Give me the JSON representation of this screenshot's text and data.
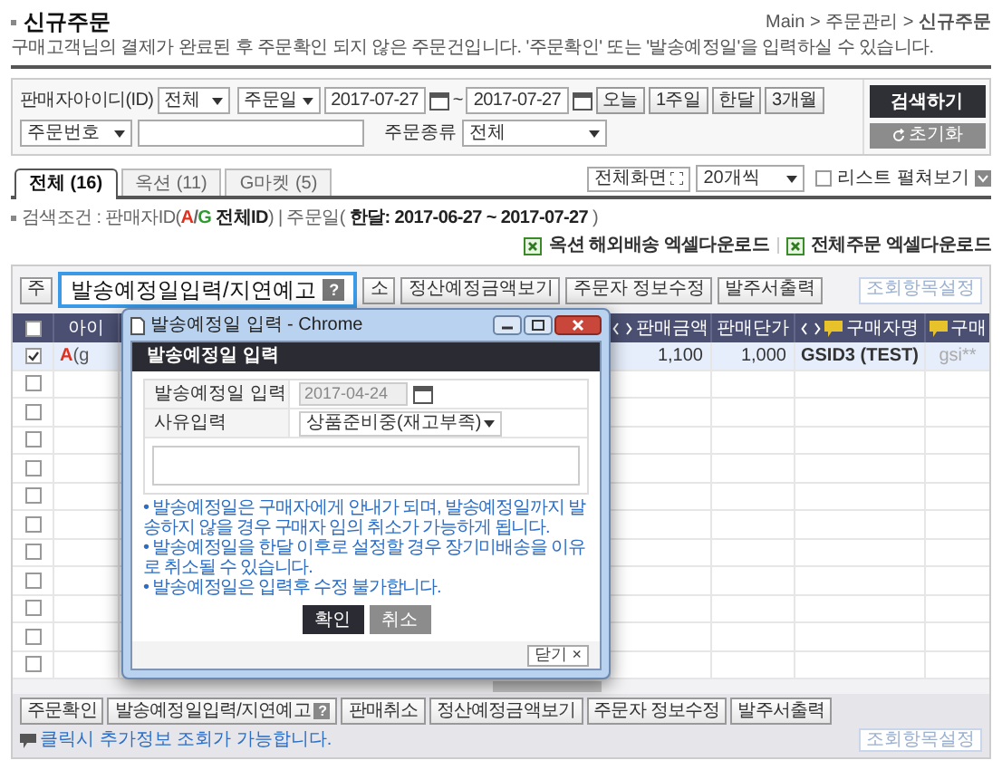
{
  "header": {
    "title": "신규주문",
    "description": "구매고객님의 결제가 완료된 후 주문확인 되지 않은 주문건입니다. '주문확인' 또는 '발송예정일'을 입력하실 수 있습니다.",
    "breadcrumb": "Main > 주문관리 > **신규주문**"
  },
  "search": {
    "seller_label": "판매자아이디(ID)",
    "seller_select": "전체",
    "date_type_select": "주문일",
    "date_from": "2017-07-27",
    "date_separator": "~",
    "date_to": "2017-07-27",
    "period_buttons": [
      "오늘",
      "1주일",
      "한달",
      "3개월"
    ],
    "order_field_select": "주문번호",
    "order_type_label": "주문종류",
    "order_type_select": "전체",
    "search_button": "검색하기",
    "reset_button": "초기화"
  },
  "tabs": [
    {
      "label": "전체 (16)",
      "selected": true
    },
    {
      "label": "옥션 (11)",
      "selected": false
    },
    {
      "label": "G마켓 (5)",
      "selected": false
    }
  ],
  "list_options": {
    "fullscreen_button": "전체화면",
    "page_size_select": "20개씩",
    "expand_list": {
      "label": "리스트 펼쳐보기",
      "checked": false
    }
  },
  "conditions": [
    {
      "text": "검색조건 : 판매자ID(",
      "color": "#666666",
      "bold": false
    },
    {
      "text": "A",
      "color": "#e0301e",
      "bold": true
    },
    {
      "text": "/",
      "color": "#666666",
      "bold": true
    },
    {
      "text": "G",
      "color": "#2f9a30",
      "bold": true
    },
    {
      "text": " 전체ID",
      "color": "#222222",
      "bold": true
    },
    {
      "text": ") | 주문일( ",
      "color": "#666666",
      "bold": false
    },
    {
      "text": "한달: 2017-06-27 ~ 2017-07-27",
      "color": "#222222",
      "bold": true
    },
    {
      "text": " )",
      "color": "#666666",
      "bold": false
    }
  ],
  "downloads": [
    "옥션 해외배송 엑셀다운로드",
    "전체주문 엑셀다운로드"
  ],
  "toolbar": {
    "buttons": [
      {
        "label": "주",
        "kind": "plain"
      },
      {
        "label": "발송예정일입력/지연예고",
        "kind": "highlighted",
        "help_icon": "?"
      },
      {
        "label": "소",
        "kind": "plain"
      },
      {
        "label": "정산예정금액보기",
        "kind": "plain"
      },
      {
        "label": "주문자 정보수정",
        "kind": "plain"
      },
      {
        "label": "발주서출력",
        "kind": "plain"
      }
    ],
    "settings_button": "조회항목설정"
  },
  "table": {
    "select_all_checked": false,
    "columns": [
      {
        "label": "아이",
        "sortable": false,
        "comment_icon": false
      },
      {
        "label": "판매금액",
        "sortable": true,
        "comment_icon": false
      },
      {
        "label": "판매단가",
        "sortable": false,
        "comment_icon": false
      },
      {
        "label": "구매자명",
        "sortable": true,
        "comment_icon": true
      },
      {
        "label": "구매",
        "sortable": false,
        "comment_icon": true
      }
    ],
    "rows": [
      {
        "checked": true,
        "selected": true,
        "market": {
          "label": "A",
          "color": "#e0301e"
        },
        "cells": [
          "(g",
          "1,100",
          "1,000",
          "GSID3 (TEST)",
          "gsi**"
        ]
      },
      {
        "checked": false,
        "selected": false
      },
      {
        "checked": false,
        "selected": false
      },
      {
        "checked": false,
        "selected": false
      },
      {
        "checked": false,
        "selected": false
      },
      {
        "checked": false,
        "selected": false
      },
      {
        "checked": false,
        "selected": false
      },
      {
        "checked": false,
        "selected": false
      },
      {
        "checked": false,
        "selected": false
      },
      {
        "checked": false,
        "selected": false
      },
      {
        "checked": false,
        "selected": false
      },
      {
        "checked": false,
        "selected": false
      }
    ]
  },
  "popup": {
    "window_title": "발송예정일 입력 - Chrome",
    "heading": "발송예정일 입력",
    "fields": [
      {
        "label": "발송예정일 입력",
        "kind": "date",
        "value": "2017-04-24"
      },
      {
        "label": "사유입력",
        "kind": "select",
        "value": "상품준비중(재고부족)"
      }
    ],
    "notes": [
      "• 발송예정일은 구매자에게 안내가 되며, 발송예정일까지 발송하지 않을 경우 구매자 임의 취소가 가능하게 됩니다.",
      "• 발송예정일을 한달 이후로 설정할 경우 장기미배송을 이유로 취소될 수 있습니다.",
      "• 발송예정일은 입력후 수정 불가합니다."
    ],
    "confirm_button": "확인",
    "cancel_button": "취소",
    "close_button": "닫기 ×"
  },
  "bottom_toolbar": {
    "buttons": [
      {
        "label": "주문확인"
      },
      {
        "label": "발송예정일입력/지연예고",
        "help_icon": "?"
      },
      {
        "label": "판매취소"
      },
      {
        "label": "정산예정금액보기"
      },
      {
        "label": "주문자 정보수정"
      },
      {
        "label": "발주서출력"
      }
    ],
    "settings_button": "조회항목설정",
    "hint": "클릭시 추가정보 조회가 가능합니다."
  }
}
